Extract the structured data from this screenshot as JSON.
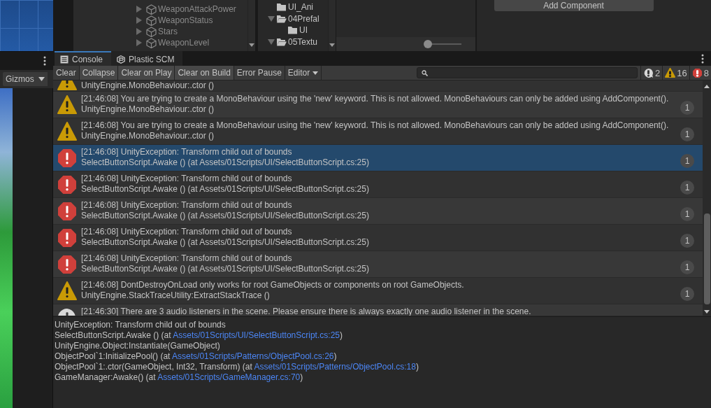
{
  "left_panel": {
    "gizmos_button": "Gizmos"
  },
  "hierarchy": {
    "items": [
      {
        "name": "WeaponAttackPower",
        "expanded": false
      },
      {
        "name": "WeaponStatus",
        "expanded": false
      },
      {
        "name": "Stars",
        "expanded": false
      },
      {
        "name": "WeaponLevel",
        "expanded": false
      }
    ]
  },
  "project": {
    "items": [
      {
        "name": "UI_Ani"
      },
      {
        "name": "04Prefal",
        "expanded": true,
        "children": [
          {
            "name": "UI"
          }
        ]
      },
      {
        "name": "05Textu",
        "expanded": true
      }
    ]
  },
  "preview_slider": {
    "level": 0
  },
  "inspector": {
    "add_component_button": "Add Component"
  },
  "console": {
    "tabs": [
      {
        "label": "Console",
        "kind": "console",
        "selected": true
      },
      {
        "label": "Plastic SCM",
        "kind": "plastic",
        "selected": false
      }
    ],
    "toolbar": [
      {
        "label": "Clear",
        "kind": "button",
        "on": false
      },
      {
        "label": "Collapse",
        "kind": "toggle",
        "on": true
      },
      {
        "label": "Clear on Play",
        "kind": "toggle",
        "on": true
      },
      {
        "label": "Clear on Build",
        "kind": "toggle",
        "on": true
      },
      {
        "label": "Error Pause",
        "kind": "toggle",
        "on": false
      },
      {
        "label": "Editor",
        "kind": "dropdown",
        "on": false
      }
    ],
    "counters": [
      {
        "kind": "info",
        "count": "2"
      },
      {
        "kind": "warning",
        "count": "16"
      },
      {
        "kind": "error",
        "count": "8"
      }
    ],
    "entries": [
      {
        "kind": "warning",
        "selected": false,
        "lines": [
          "UnityEngine.MonoBehaviour:.ctor ()"
        ]
      },
      {
        "kind": "warning",
        "selected": false,
        "lines": [
          "[21:46:08] You are trying to create a MonoBehaviour using the 'new' keyword.  This is not allowed.  MonoBehaviours can only be added using AddComponent().",
          "UnityEngine.MonoBehaviour:.ctor ()"
        ],
        "count": "1"
      },
      {
        "kind": "warning",
        "selected": false,
        "lines": [
          "[21:46:08] You are trying to create a MonoBehaviour using the 'new' keyword.  This is not allowed.  MonoBehaviours can only be added using AddComponent().",
          "UnityEngine.MonoBehaviour:.ctor ()"
        ],
        "count": "1"
      },
      {
        "kind": "error",
        "selected": true,
        "lines": [
          "[21:46:08] UnityException: Transform child out of bounds",
          "SelectButtonScript.Awake () (at Assets/01Scripts/UI/SelectButtonScript.cs:25)"
        ],
        "count": "1"
      },
      {
        "kind": "error",
        "selected": false,
        "lines": [
          "[21:46:08] UnityException: Transform child out of bounds",
          "SelectButtonScript.Awake () (at Assets/01Scripts/UI/SelectButtonScript.cs:25)"
        ],
        "count": "1"
      },
      {
        "kind": "error",
        "selected": false,
        "lines": [
          "[21:46:08] UnityException: Transform child out of bounds",
          "SelectButtonScript.Awake () (at Assets/01Scripts/UI/SelectButtonScript.cs:25)"
        ],
        "count": "1"
      },
      {
        "kind": "error",
        "selected": false,
        "lines": [
          "[21:46:08] UnityException: Transform child out of bounds",
          "SelectButtonScript.Awake () (at Assets/01Scripts/UI/SelectButtonScript.cs:25)"
        ],
        "count": "1"
      },
      {
        "kind": "error",
        "selected": false,
        "lines": [
          "[21:46:08] UnityException: Transform child out of bounds",
          "SelectButtonScript.Awake () (at Assets/01Scripts/UI/SelectButtonScript.cs:25)"
        ],
        "count": "1"
      },
      {
        "kind": "warning",
        "selected": false,
        "lines": [
          "[21:46:08] DontDestroyOnLoad only works for root GameObjects or components on root GameObjects.",
          "UnityEngine.StackTraceUtility:ExtractStackTrace ()"
        ],
        "count": "1"
      },
      {
        "kind": "info",
        "selected": false,
        "lines": [
          "[21:46:30] There are 3 audio listeners in the scene. Please ensure there is always exactly one audio listener in the scene."
        ]
      }
    ],
    "details": [
      {
        "text": "UnityException: Transform child out of bounds"
      },
      {
        "text": "SelectButtonScript.Awake () (at ",
        "link": "Assets/01Scripts/UI/SelectButtonScript.cs:25",
        "suffix": ")"
      },
      {
        "text": "UnityEngine.Object:Instantiate(GameObject)"
      },
      {
        "text": "ObjectPool`1:InitializePool() (at ",
        "link": "Assets/01Scripts/Patterns/ObjectPool.cs:26",
        "suffix": ")"
      },
      {
        "text": "ObjectPool`1:.ctor(GameObject, Int32, Transform) (at ",
        "link": "Assets/01Scripts/Patterns/ObjectPool.cs:18",
        "suffix": ")"
      },
      {
        "text": "GameManager:Awake() (at ",
        "link": "Assets/01Scripts/GameManager.cs:70",
        "suffix": ")"
      }
    ]
  }
}
